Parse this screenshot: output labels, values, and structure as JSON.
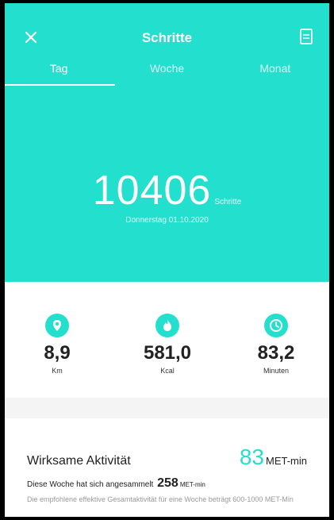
{
  "header": {
    "title": "Schritte",
    "close_icon": "close-icon",
    "document_icon": "document-icon"
  },
  "tabs": [
    {
      "label": "Tag",
      "active": true
    },
    {
      "label": "Woche",
      "active": false
    },
    {
      "label": "Monat",
      "active": false
    }
  ],
  "summary": {
    "steps": "10406",
    "unit": "Schritte",
    "date": "Donnerstag 01.10.2020"
  },
  "stats": [
    {
      "icon": "location-pin-icon",
      "value": "8,9",
      "label": "Km"
    },
    {
      "icon": "flame-icon",
      "value": "581,0",
      "label": "Kcal"
    },
    {
      "icon": "clock-icon",
      "value": "83,2",
      "label": "Minuten"
    }
  ],
  "activity": {
    "title": "Wirksame Aktivität",
    "value": "83",
    "unit": "MET-min",
    "week_text": "Diese Woche hat sich angesammelt",
    "week_value": "258",
    "week_unit": "MET-min",
    "note": "Die empfohlene effektive Gesamtaktivität für eine Woche beträgt 600-1000 MET-Min"
  },
  "colors": {
    "accent": "#23dfcd",
    "background": "#f4f4f4"
  }
}
